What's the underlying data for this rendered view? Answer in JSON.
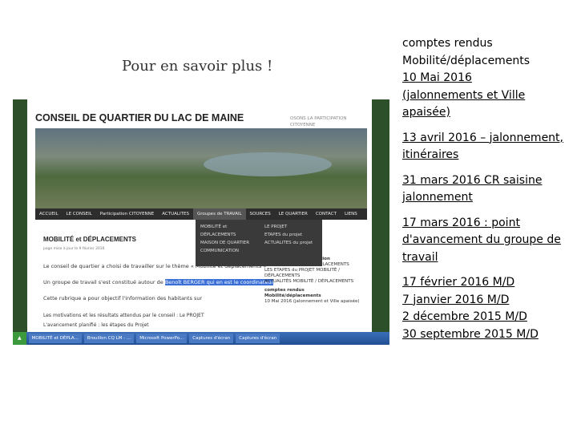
{
  "slide": {
    "title": "Pour en savoir plus !"
  },
  "links": {
    "group1": {
      "heading": "comptes rendus",
      "heading2": "Mobilité/déplacements",
      "link1": "10 Mai 2016",
      "link1b": "(jalonnements et Ville apaisée)"
    },
    "group2": {
      "link": "13 avril 2016 – jalonnement, itinéraires"
    },
    "group3": {
      "link": "31 mars 2016 CR saisine jalonnement"
    },
    "group4": {
      "link": "17 mars 2016 : point d'avancement du groupe de travail"
    },
    "group5": [
      "17 février 2016 M/D",
      "7 janvier 2016 M/D",
      "2 décembre 2015 M/D",
      "30 septembre 2015 M/D"
    ]
  },
  "screenshot": {
    "site_title": "CONSEIL DE QUARTIER DU LAC DE MAINE",
    "site_sub": "OSONS LA PARTICIPATION CITOYENNE",
    "nav": [
      "ACCUEIL",
      "LE CONSEIL",
      "Participation CITOYENNE",
      "ACTUALITES",
      "Groupes de TRAVAIL",
      "SOURCES",
      "LE QUARTIER",
      "CONTACT",
      "LIENS"
    ],
    "dropdown_left": [
      "MOBILITÉ et",
      "DÉPLACEMENTS",
      "MAISON DE QUARTIER",
      "COMMUNICATION"
    ],
    "dropdown_right": [
      "LE PROJET",
      "ETAPES du projet",
      "ACTUALITES du projet"
    ],
    "content_heading": "MOBILITÉ et DÉPLACEMENTS",
    "content_meta": "page mise à jour le 9 février 2016",
    "para1": "Le conseil de quartier a choisi de travailler sur le thème « Mobilité et déplacements »",
    "para2_a": "Un groupe de travail s'est constitué autour de",
    "para2_hl": "Benoît BERGER qui en est le coordinateur",
    "para3": "Cette rubrique a pour objectif l'information des habitants sur",
    "bullet1": "Les motivations et les résultats attendus par le conseil : Le PROJET",
    "bullet2": "L'avancement planifié : les étapes du Projet",
    "side_title": "processus de concertation",
    "side_items": [
      "LE PROJET MOBILITÉ / DÉPLACEMENTS",
      "LES ETAPES du PROJET MOBILITÉ / DÉPLACEMENTS",
      "ACTUALITÉS MOBILITÉ / DÉPLACEMENTS"
    ],
    "side_cr": "comptes rendus Mobilité/déplacements",
    "side_cr_item": "10 Mai 2016 (jalonnement et Ville apaisée)",
    "taskbar": [
      "MOBILITÉ et DÉPLA...",
      "Brouillon CQ LM - ...",
      "Microsoft PowerPo...",
      "Captures d'écran",
      "Captures d'écran"
    ]
  }
}
